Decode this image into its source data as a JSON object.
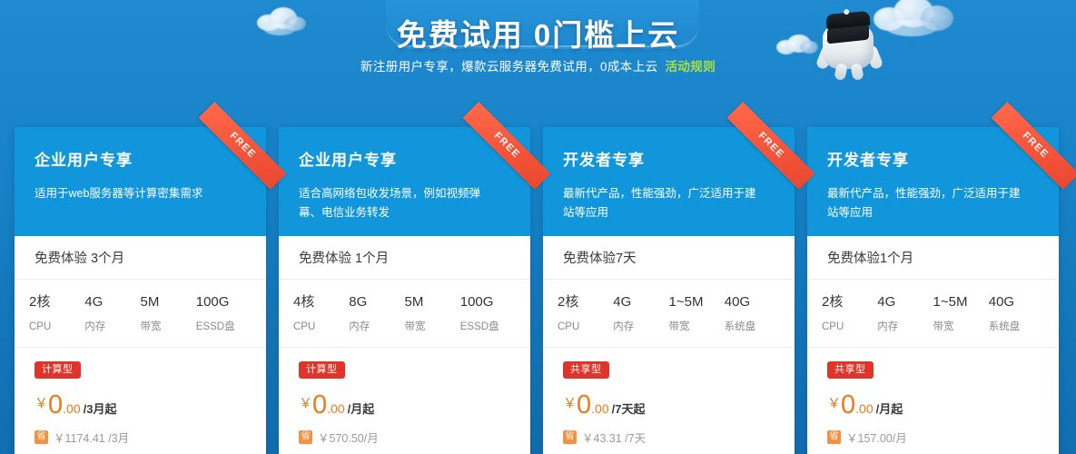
{
  "banner": {
    "title": "免费试用 0门槛上云",
    "subtitle": "新注册用户专享，爆款云服务器免费试用，0成本上云",
    "rule_link": "活动规则",
    "rule_link_color": "#a7e03f",
    "background_color": "#1378be",
    "plate_color": "#2490d6"
  },
  "decorations": {
    "mascot": "robot-graduate-mascot",
    "clouds": [
      "cloud-left",
      "cloud-right-top",
      "cloud-right-small"
    ]
  },
  "ribbon_label": "FREE",
  "cards": [
    {
      "title": "企业用户专享",
      "desc": "适用于web服务器等计算密集需求",
      "trial": "免费体验 3个月",
      "specs": [
        {
          "value": "2核",
          "label": "CPU"
        },
        {
          "value": "4G",
          "label": "内存"
        },
        {
          "value": "5M",
          "label": "带宽"
        },
        {
          "value": "100G",
          "label": "ESSD盘"
        }
      ],
      "tag": "计算型",
      "tag_color": "#e0342a",
      "price_currency": "￥",
      "price_int": "0",
      "price_dec": ".00",
      "price_unit": "/3月起",
      "save_badge": "省",
      "original_price": "￥1174.41 /3月"
    },
    {
      "title": "企业用户专享",
      "desc": "适合高网络包收发场景，例如视频弹幕、电信业务转发",
      "trial": "免费体验 1个月",
      "specs": [
        {
          "value": "4核",
          "label": "CPU"
        },
        {
          "value": "8G",
          "label": "内存"
        },
        {
          "value": "5M",
          "label": "带宽"
        },
        {
          "value": "100G",
          "label": "ESSD盘"
        }
      ],
      "tag": "计算型",
      "tag_color": "#e0342a",
      "price_currency": "￥",
      "price_int": "0",
      "price_dec": ".00",
      "price_unit": "/月起",
      "save_badge": "省",
      "original_price": "￥570.50/月"
    },
    {
      "title": "开发者专享",
      "desc": "最新代产品，性能强劲，广泛适用于建站等应用",
      "trial": "免费体验7天",
      "specs": [
        {
          "value": "2核",
          "label": "CPU"
        },
        {
          "value": "4G",
          "label": "内存"
        },
        {
          "value": "1~5M",
          "label": "带宽"
        },
        {
          "value": "40G",
          "label": "系统盘"
        }
      ],
      "tag": "共享型",
      "tag_color": "#e0342a",
      "price_currency": "￥",
      "price_int": "0",
      "price_dec": ".00",
      "price_unit": "/7天起",
      "save_badge": "省",
      "original_price": "￥43.31 /7天"
    },
    {
      "title": "开发者专享",
      "desc": "最新代产品，性能强劲，广泛适用于建站等应用",
      "trial": "免费体验1个月",
      "specs": [
        {
          "value": "2核",
          "label": "CPU"
        },
        {
          "value": "4G",
          "label": "内存"
        },
        {
          "value": "1~5M",
          "label": "带宽"
        },
        {
          "value": "40G",
          "label": "系统盘"
        }
      ],
      "tag": "共享型",
      "tag_color": "#e0342a",
      "price_currency": "￥",
      "price_int": "0",
      "price_dec": ".00",
      "price_unit": "/月起",
      "save_badge": "省",
      "original_price": "￥157.00/月"
    }
  ]
}
